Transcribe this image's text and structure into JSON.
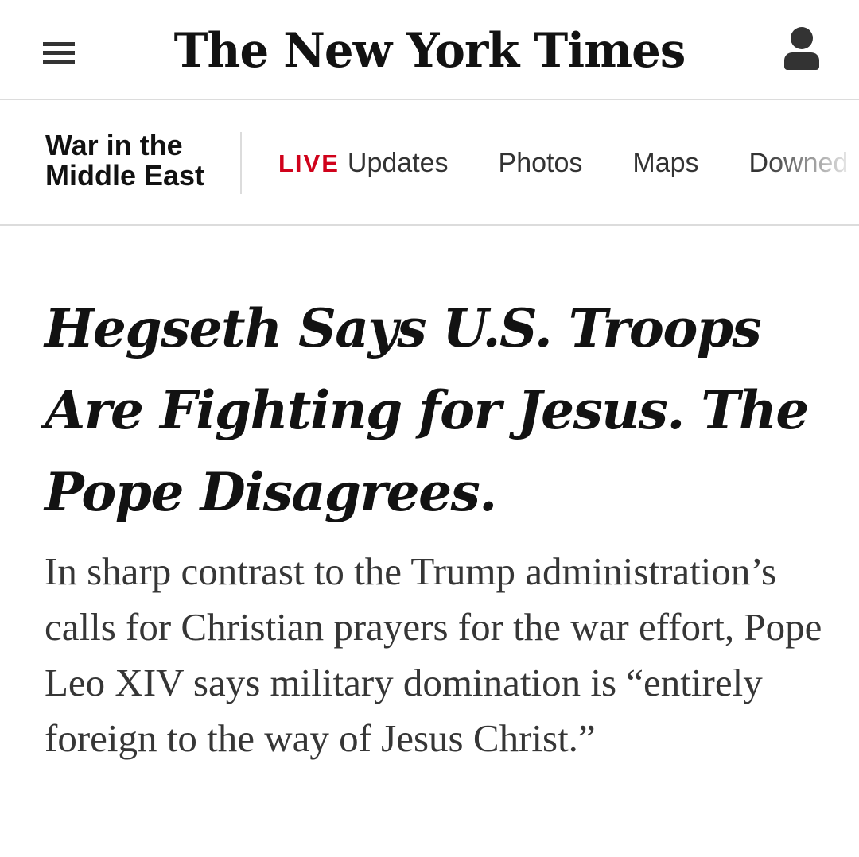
{
  "masthead": {
    "logo_text": "The New York Times",
    "menu_icon": "hamburger-menu-icon",
    "account_icon": "user-account-icon"
  },
  "section_nav": {
    "section_title": "War in the Middle East",
    "live_label": "LIVE",
    "links": [
      {
        "label": "Updates"
      },
      {
        "label": "Photos"
      },
      {
        "label": "Maps"
      },
      {
        "label": "Downed"
      }
    ],
    "live_color": "#d0021b"
  },
  "article": {
    "headline": "Hegseth Says U.S. Troops Are Fighting for Jesus. The Pope Disagrees.",
    "summary": "In sharp contrast to the Trump administration’s calls for Christian prayers for the war effort, Pope Leo XIV says military domination is “entirely foreign to the way of Jesus Christ.”"
  }
}
